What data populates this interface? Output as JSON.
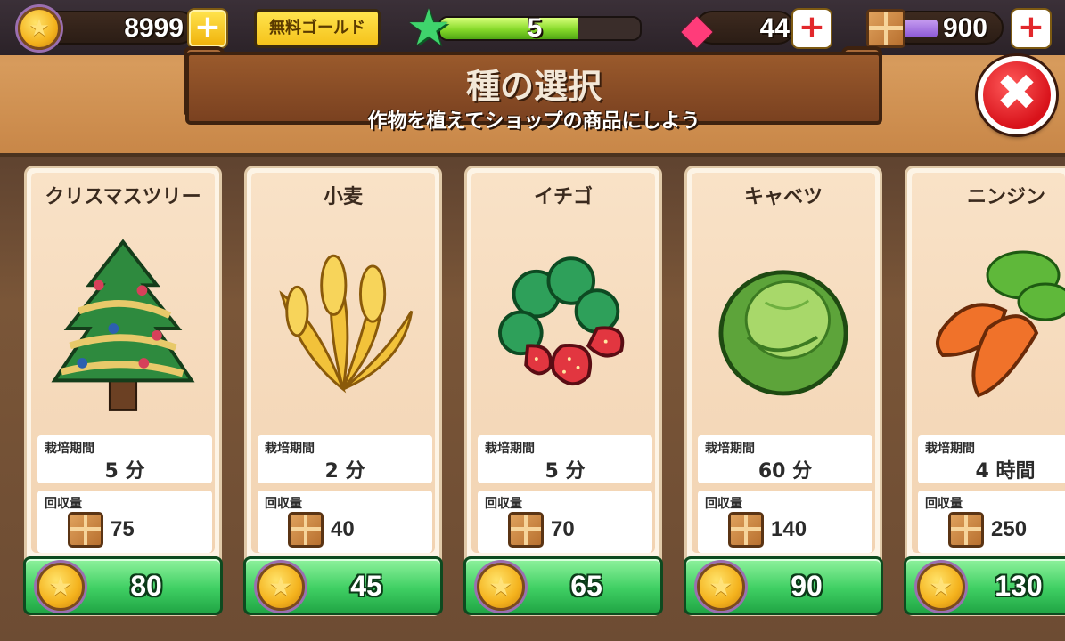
{
  "hud": {
    "coins": "8999",
    "free_gold_label": "無料ゴールド",
    "level": "5",
    "xp_progress": 0.69,
    "gems": "44",
    "boxes": "900",
    "plus_symbol": "+"
  },
  "header": {
    "title": "種の選択",
    "subtitle": "作物を植えてショップの商品にしよう",
    "close_symbol": "✖"
  },
  "labels": {
    "period": "栽培期間",
    "yield": "回収量"
  },
  "crops": [
    {
      "name": "クリスマスツリー",
      "period": "5 分",
      "yield": "75",
      "price": "80",
      "icon": "christmas-tree-icon"
    },
    {
      "name": "小麦",
      "period": "2 分",
      "yield": "40",
      "price": "45",
      "icon": "wheat-icon"
    },
    {
      "name": "イチゴ",
      "period": "5 分",
      "yield": "70",
      "price": "65",
      "icon": "strawberry-icon"
    },
    {
      "name": "キャベツ",
      "period": "60 分",
      "yield": "140",
      "price": "90",
      "icon": "cabbage-icon"
    },
    {
      "name": "ニンジン",
      "period": "4 時間",
      "yield": "250",
      "price": "130",
      "icon": "carrot-icon"
    }
  ],
  "colors": {
    "buy_button": "#3fcf63",
    "close_button": "#d8121a",
    "board": "#8a4c25"
  }
}
